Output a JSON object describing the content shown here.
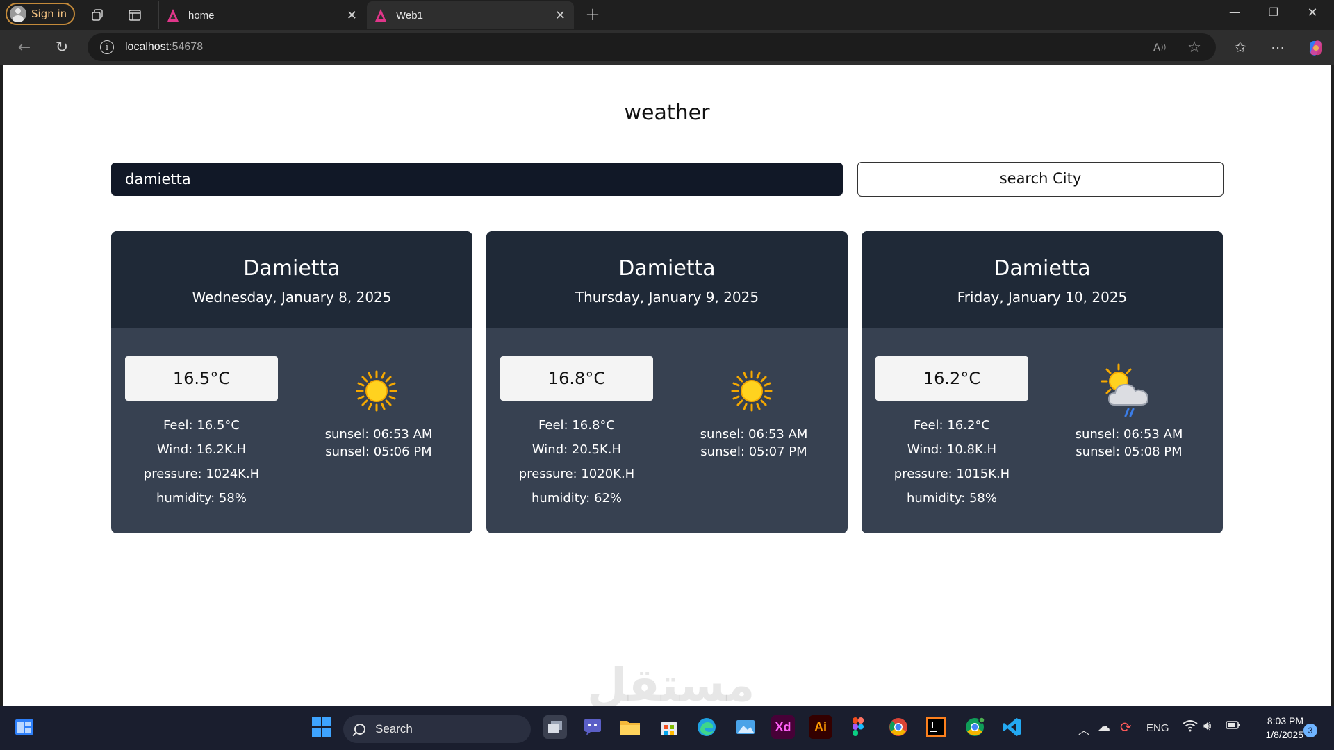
{
  "browser": {
    "signin_label": "Sign in",
    "tabs": [
      {
        "title": "home",
        "active": false
      },
      {
        "title": "Web1",
        "active": true
      }
    ],
    "address": {
      "host": "localhost",
      "port": ":54678"
    }
  },
  "page": {
    "title": "weather",
    "search": {
      "value": "damietta",
      "button_label": "search City"
    },
    "cards": [
      {
        "city": "Damietta",
        "date": "Wednesday, January 8, 2025",
        "temp": "16.5°C",
        "feel": "Feel: 16.5°C",
        "wind": "Wind: 16.2K.H",
        "pressure": "pressure: 1024K.H",
        "humidity": "humidity: 58%",
        "sunrise": "sunsel: 06:53 AM",
        "sunset": "sunsel: 05:06 PM",
        "icon": "sun-icon"
      },
      {
        "city": "Damietta",
        "date": "Thursday, January 9, 2025",
        "temp": "16.8°C",
        "feel": "Feel: 16.8°C",
        "wind": "Wind: 20.5K.H",
        "pressure": "pressure: 1020K.H",
        "humidity": "humidity: 62%",
        "sunrise": "sunsel: 06:53 AM",
        "sunset": "sunsel: 05:07 PM",
        "icon": "sun-icon"
      },
      {
        "city": "Damietta",
        "date": "Friday, January 10, 2025",
        "temp": "16.2°C",
        "feel": "Feel: 16.2°C",
        "wind": "Wind: 10.8K.H",
        "pressure": "pressure: 1015K.H",
        "humidity": "humidity: 58%",
        "sunrise": "sunsel: 06:53 AM",
        "sunset": "sunsel: 05:08 PM",
        "icon": "sun-cloud-rain-icon"
      }
    ],
    "watermark": "مستقل"
  },
  "taskbar": {
    "search_label": "Search",
    "apps": [
      "windows-start-icon",
      "file-explorer-icon",
      "teams-icon",
      "folder-icon",
      "store-icon",
      "edge-icon",
      "photos-icon",
      "adobe-xd-icon",
      "illustrator-icon",
      "figma-icon",
      "chrome-icon",
      "jetbrains-icon",
      "chrome-beta-icon",
      "vscode-icon"
    ],
    "xd_label": "Xd",
    "ai_label": "Ai",
    "language": "ENG",
    "time": "8:03 PM",
    "date": "1/8/2025",
    "notification_count": "3"
  },
  "colors": {
    "card_header": "#1f2937",
    "card_body": "#374151",
    "input_bg": "#111827",
    "tab_favicon": "#e0368a"
  }
}
